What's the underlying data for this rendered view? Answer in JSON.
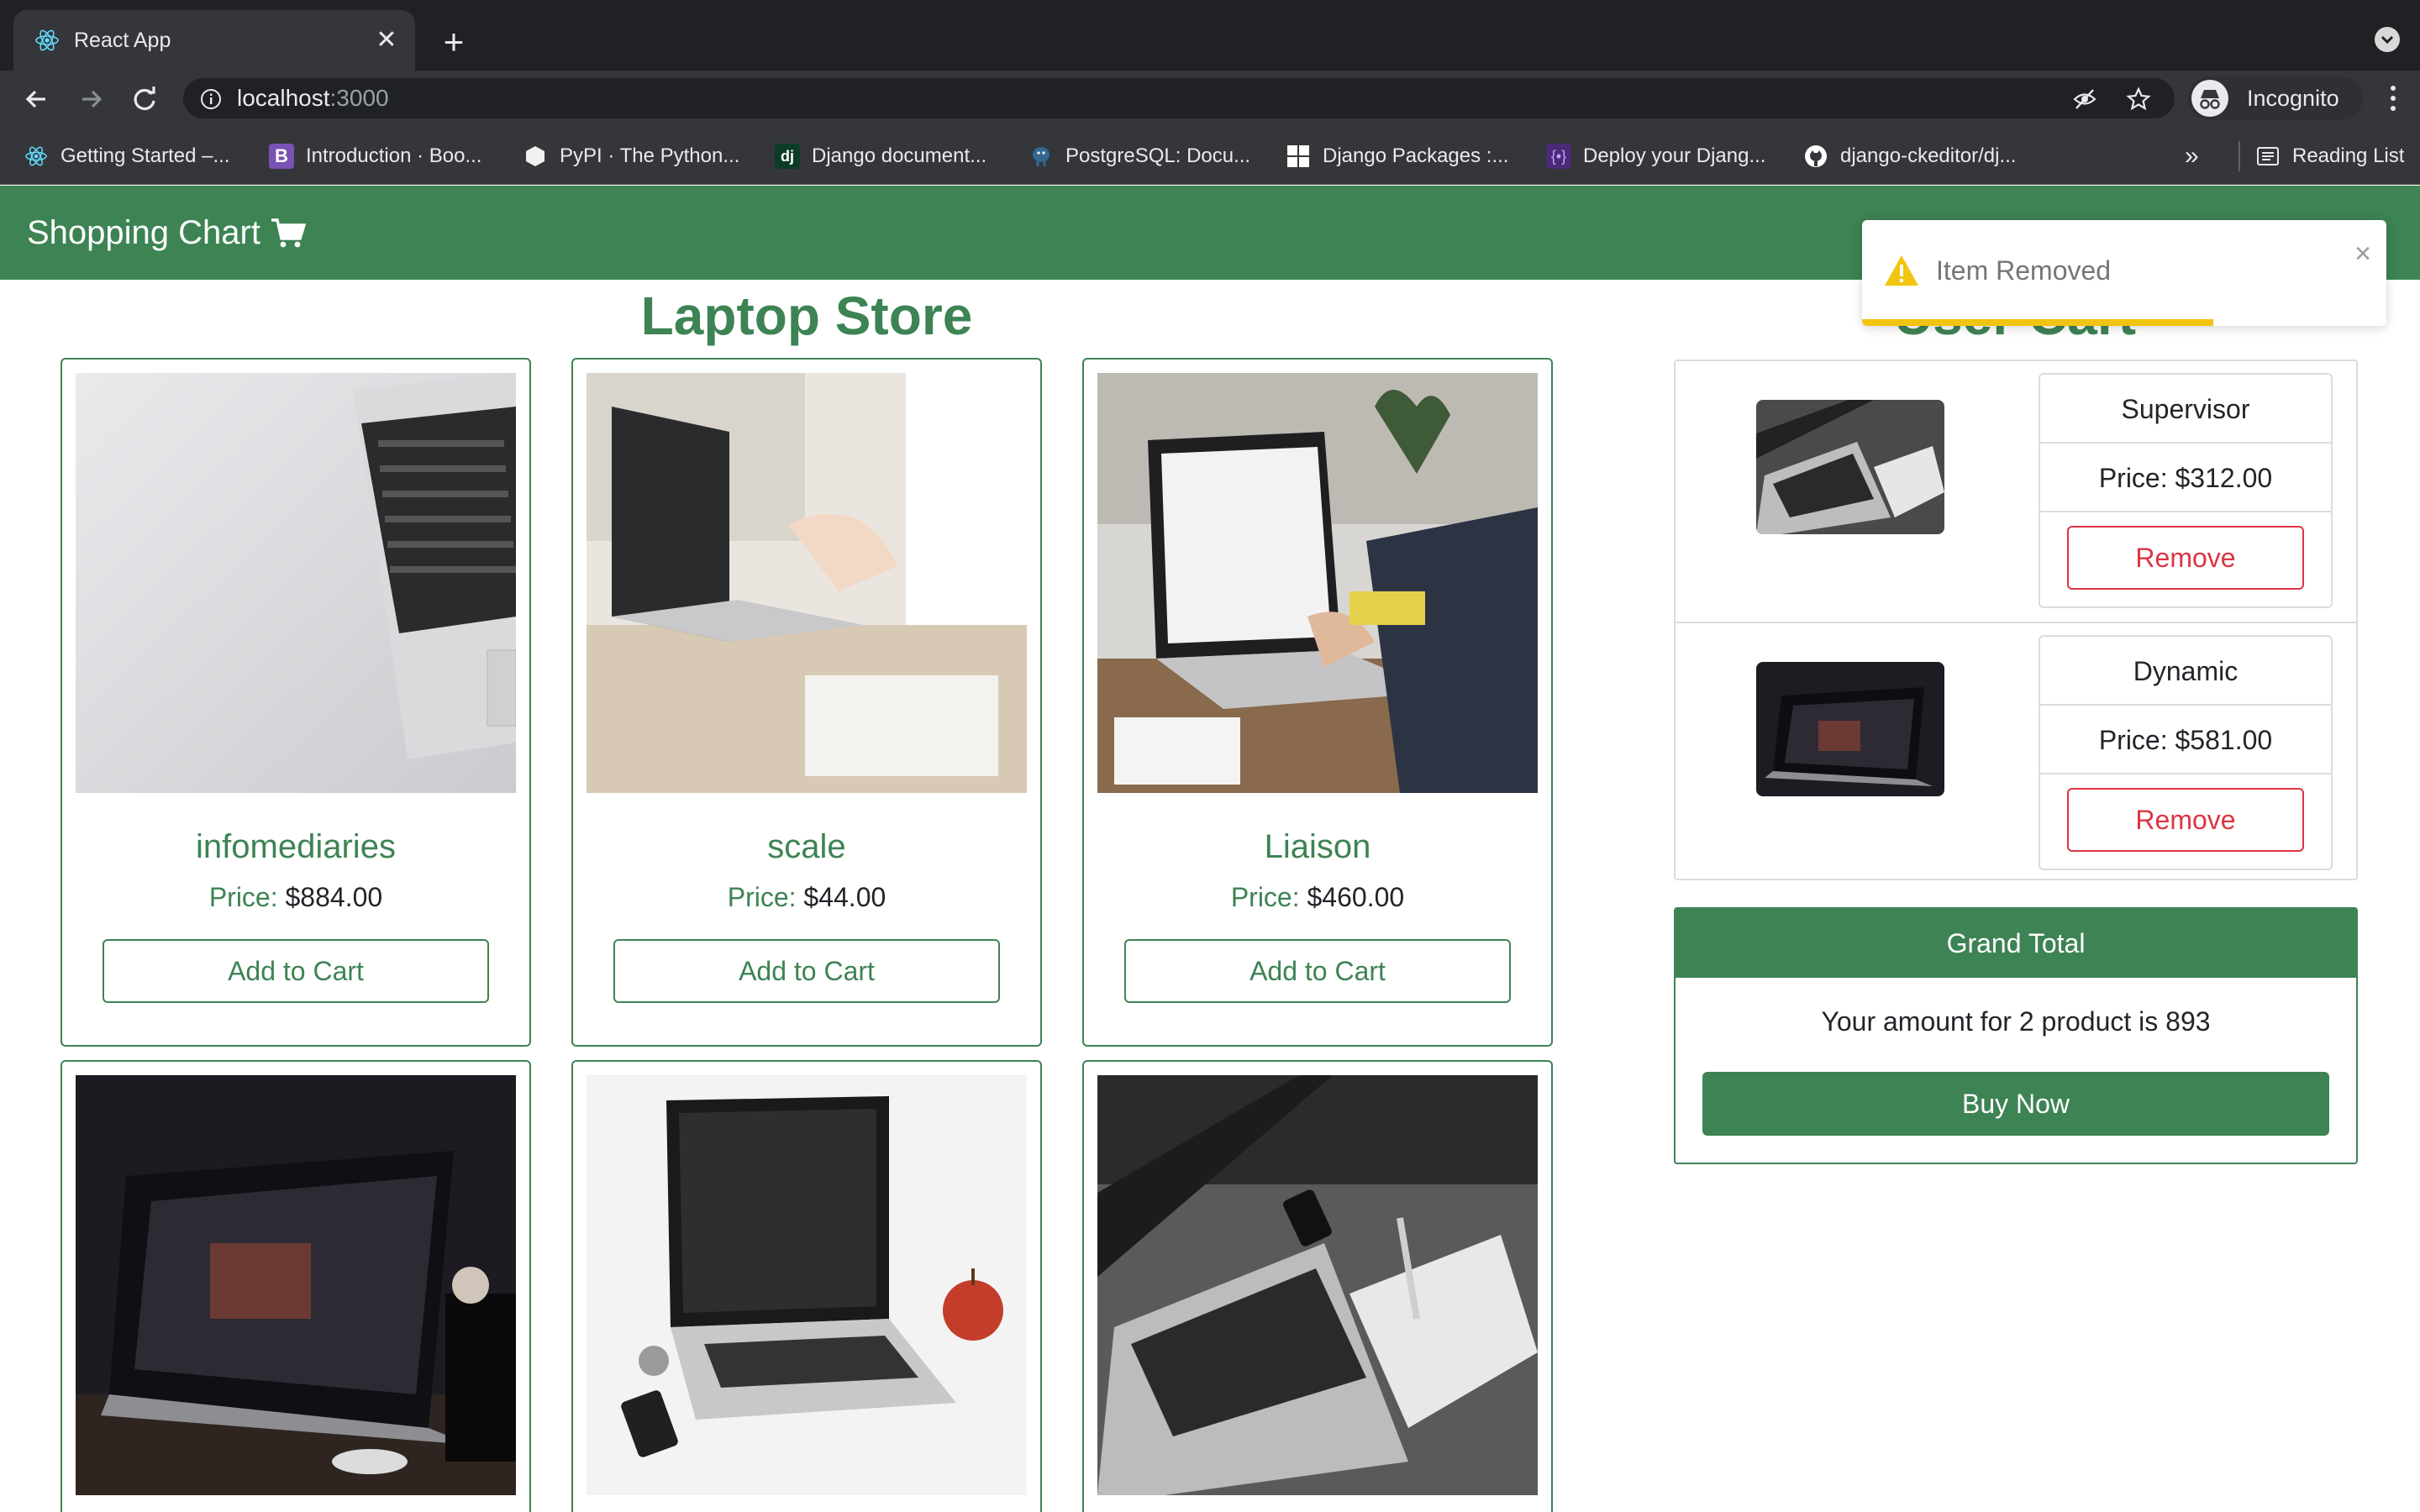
{
  "browser": {
    "tab_title": "React App",
    "url_host": "localhost",
    "url_port": ":3000",
    "incognito_label": "Incognito",
    "bookmarks": [
      "Getting Started –...",
      "Introduction · Boo...",
      "PyPI · The Python...",
      "Django document...",
      "PostgreSQL: Docu...",
      "Django Packages :...",
      "Deploy your Djang...",
      "django-ckeditor/dj..."
    ],
    "bookmarks_more": "»",
    "reading_list": "Reading List"
  },
  "app": {
    "brand": "Shopping Chart",
    "store_title": "Laptop Store",
    "cart_title": "User Cart"
  },
  "products": [
    {
      "name": "infomediaries",
      "price_label": "Price:",
      "price": "$884.00",
      "button": "Add to Cart"
    },
    {
      "name": "scale",
      "price_label": "Price:",
      "price": "$44.00",
      "button": "Add to Cart"
    },
    {
      "name": "Liaison",
      "price_label": "Price:",
      "price": "$460.00",
      "button": "Add to Cart"
    }
  ],
  "cart": {
    "items": [
      {
        "name": "Supervisor",
        "price": "Price: $312.00",
        "button": "Remove"
      },
      {
        "name": "Dynamic",
        "price": "Price: $581.00",
        "button": "Remove"
      }
    ],
    "total_header": "Grand Total",
    "total_text": "Your amount for 2 product is 893",
    "buy_button": "Buy Now"
  },
  "toast": {
    "message": "Item Removed",
    "close": "×",
    "progress_fraction": 0.67
  },
  "colors": {
    "brand_green": "#3d8354",
    "danger": "#dc3545",
    "warning": "#f1c40f"
  }
}
